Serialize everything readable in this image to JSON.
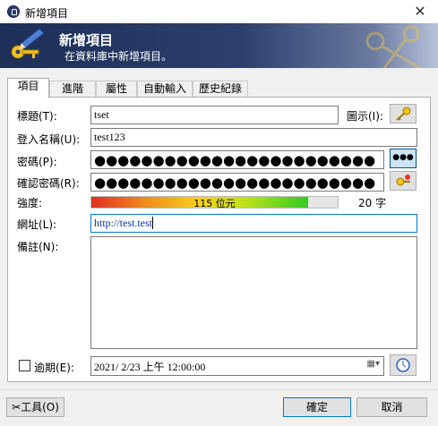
{
  "window": {
    "title": "新增項目"
  },
  "banner": {
    "title": "新增項目",
    "subtitle": "在資料庫中新增項目。"
  },
  "tabs": [
    {
      "label": "項目",
      "active": true
    },
    {
      "label": "進階"
    },
    {
      "label": "屬性"
    },
    {
      "label": "自動輸入"
    },
    {
      "label": "歷史紀錄"
    }
  ],
  "form": {
    "title_label": "標題(T):",
    "title_value": "tset",
    "icon_label": "圖示(I):",
    "username_label": "登入名稱(U):",
    "username_value": "test123",
    "password_label": "密碼(P):",
    "password_value": "●●●●●●●●●●●●●●●●●●●●●●●●",
    "show_password_button": "●●●",
    "repeat_label": "確認密碼(R):",
    "repeat_value": "●●●●●●●●●●●●●●●●●●●●●●●●",
    "quality_label": "強度:",
    "quality_text": "115 位元",
    "quality_fraction": 0.88,
    "char_count": "20 字",
    "url_label": "網址(L):",
    "url_value": "http://test.test",
    "notes_label": "備註(N):",
    "notes_value": "",
    "expires_label": "逾期(E):",
    "expires_checked": false,
    "expires_value": "2021/  2/23 上午 12:00:00"
  },
  "footer": {
    "tools_label": "工具(O)",
    "ok_label": "確定",
    "cancel_label": "取消"
  },
  "colors": {
    "banner_dark": "#1d2f57",
    "focus_blue": "#0078d7",
    "quality_green": "#2ecc1f"
  }
}
